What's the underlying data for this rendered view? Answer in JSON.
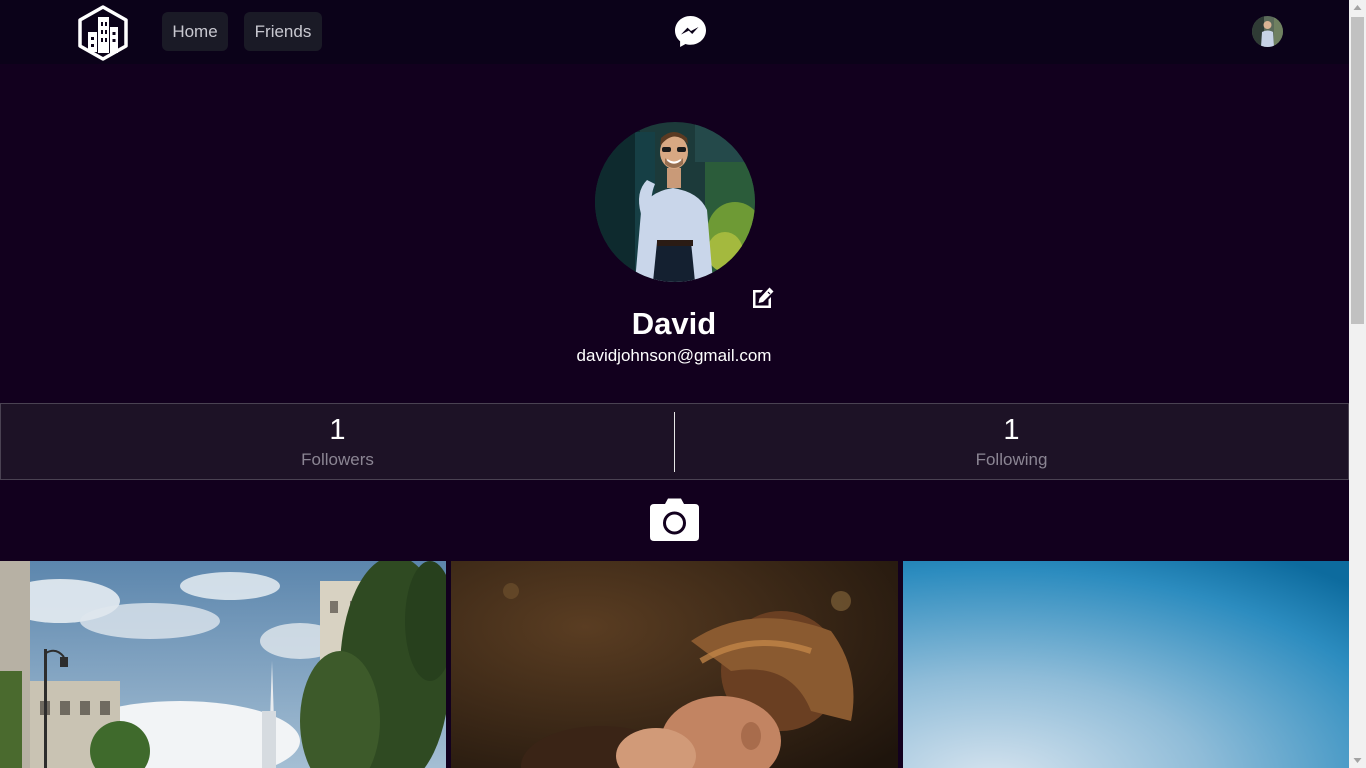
{
  "navbar": {
    "home_label": "Home",
    "friends_label": "Friends",
    "logo_icon": "city-buildings-hexagon-logo",
    "messenger_icon": "messenger-icon",
    "avatar_icon": "user-avatar"
  },
  "profile": {
    "name": "David",
    "email": "davidjohnson@gmail.com",
    "edit_icon": "edit-icon"
  },
  "stats": {
    "followers_count": "1",
    "followers_label": "Followers",
    "following_count": "1",
    "following_label": "Following"
  },
  "upload": {
    "icon": "camera-icon"
  },
  "gallery": {
    "photos": [
      "city-street-photo",
      "couple-kiss-photo",
      "blue-sky-photo"
    ]
  },
  "colors": {
    "background": "#12001e",
    "navbar": "#0b0219",
    "nav_button": "#1a1a26",
    "stats_bar": "#1d1226",
    "muted_text": "#8b8593"
  }
}
